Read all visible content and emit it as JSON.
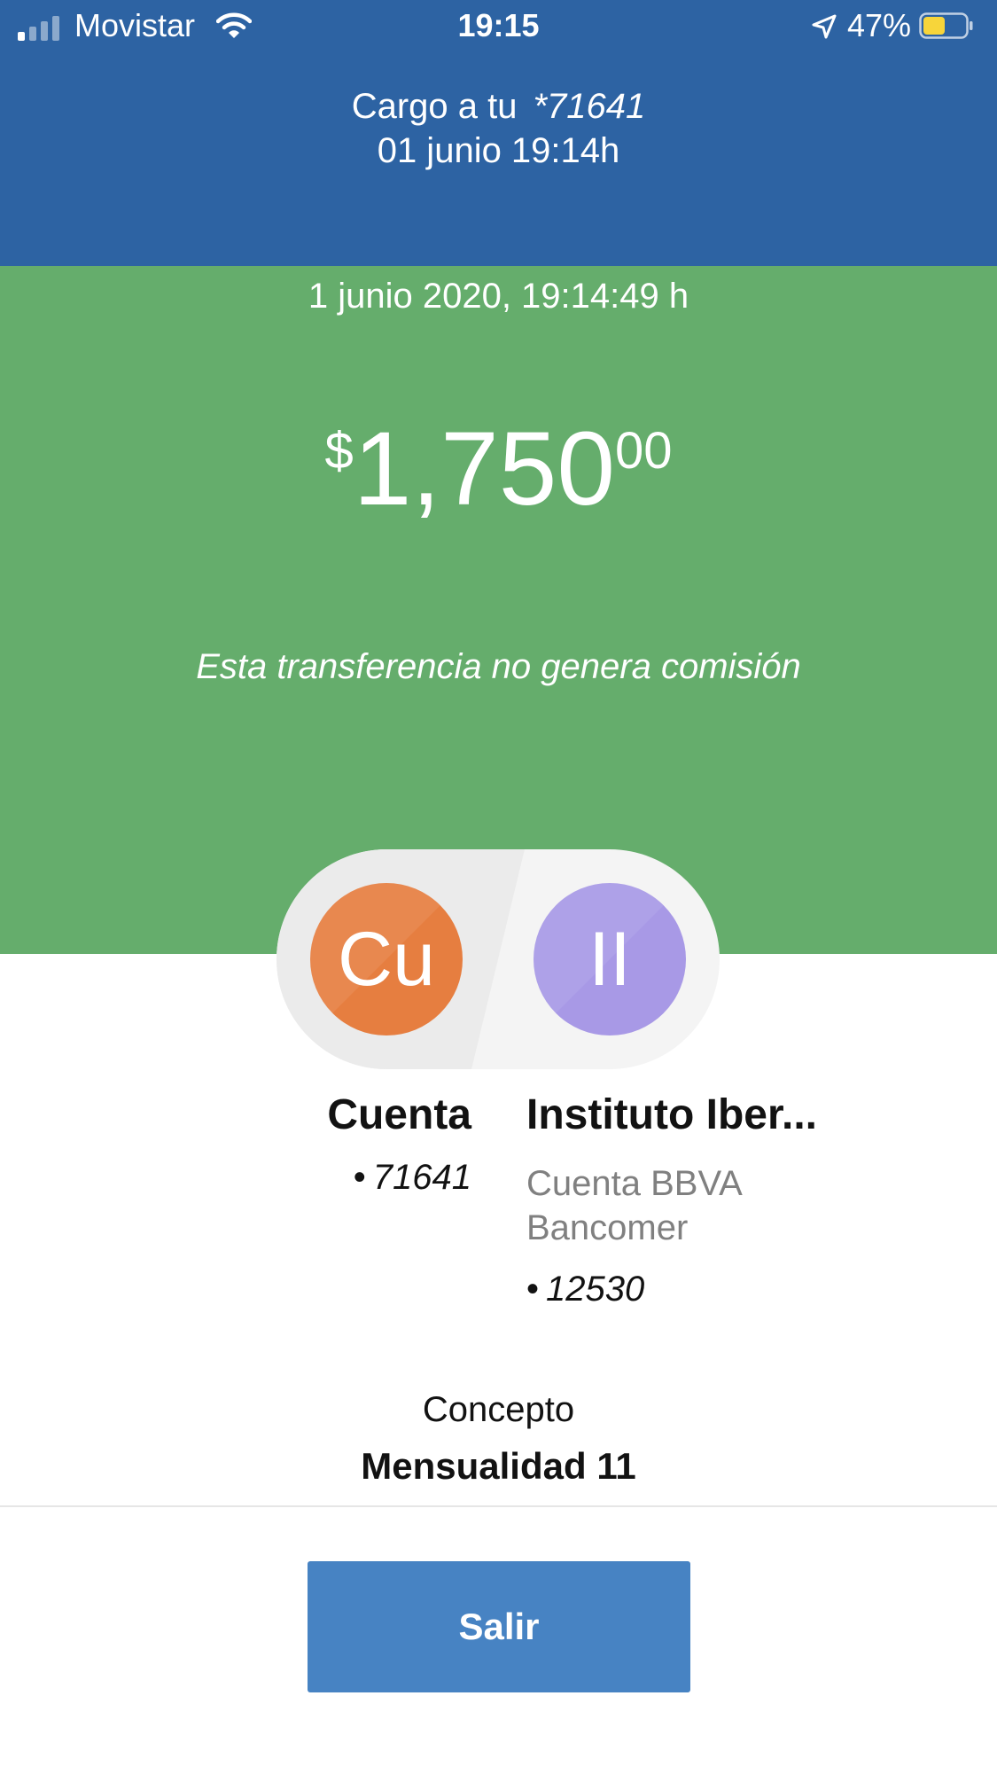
{
  "status_bar": {
    "carrier": "Movistar",
    "time": "19:15",
    "battery_percent": "47%",
    "signal_bars_active": 1,
    "icons": [
      "signal-icon",
      "wifi-icon",
      "location-arrow-icon",
      "battery-icon"
    ]
  },
  "header": {
    "charge_label": "Cargo a tu",
    "account_masked": "*71641",
    "date_time": "01 junio 19:14h"
  },
  "transaction": {
    "timestamp": "1 junio 2020, 19:14:49 h",
    "currency_symbol": "$",
    "amount_integer": "1,750",
    "amount_decimals": "00",
    "commission_note": "Esta transferencia no genera comisión"
  },
  "origin": {
    "initials": "Cu",
    "name": "Cuenta",
    "number": "71641"
  },
  "destination": {
    "initials": "II",
    "name": "Instituto Iber...",
    "bank": "Cuenta BBVA Bancomer",
    "number": "12530"
  },
  "concept": {
    "label": "Concepto",
    "value": "Mensualidad 11"
  },
  "actions": {
    "exit_label": "Salir"
  },
  "colors": {
    "header_blue": "#2d63a3",
    "success_green": "#65ad6c",
    "origin_avatar": "#e67e40",
    "destination_avatar": "#a899e6",
    "button_blue": "#4783c3"
  }
}
